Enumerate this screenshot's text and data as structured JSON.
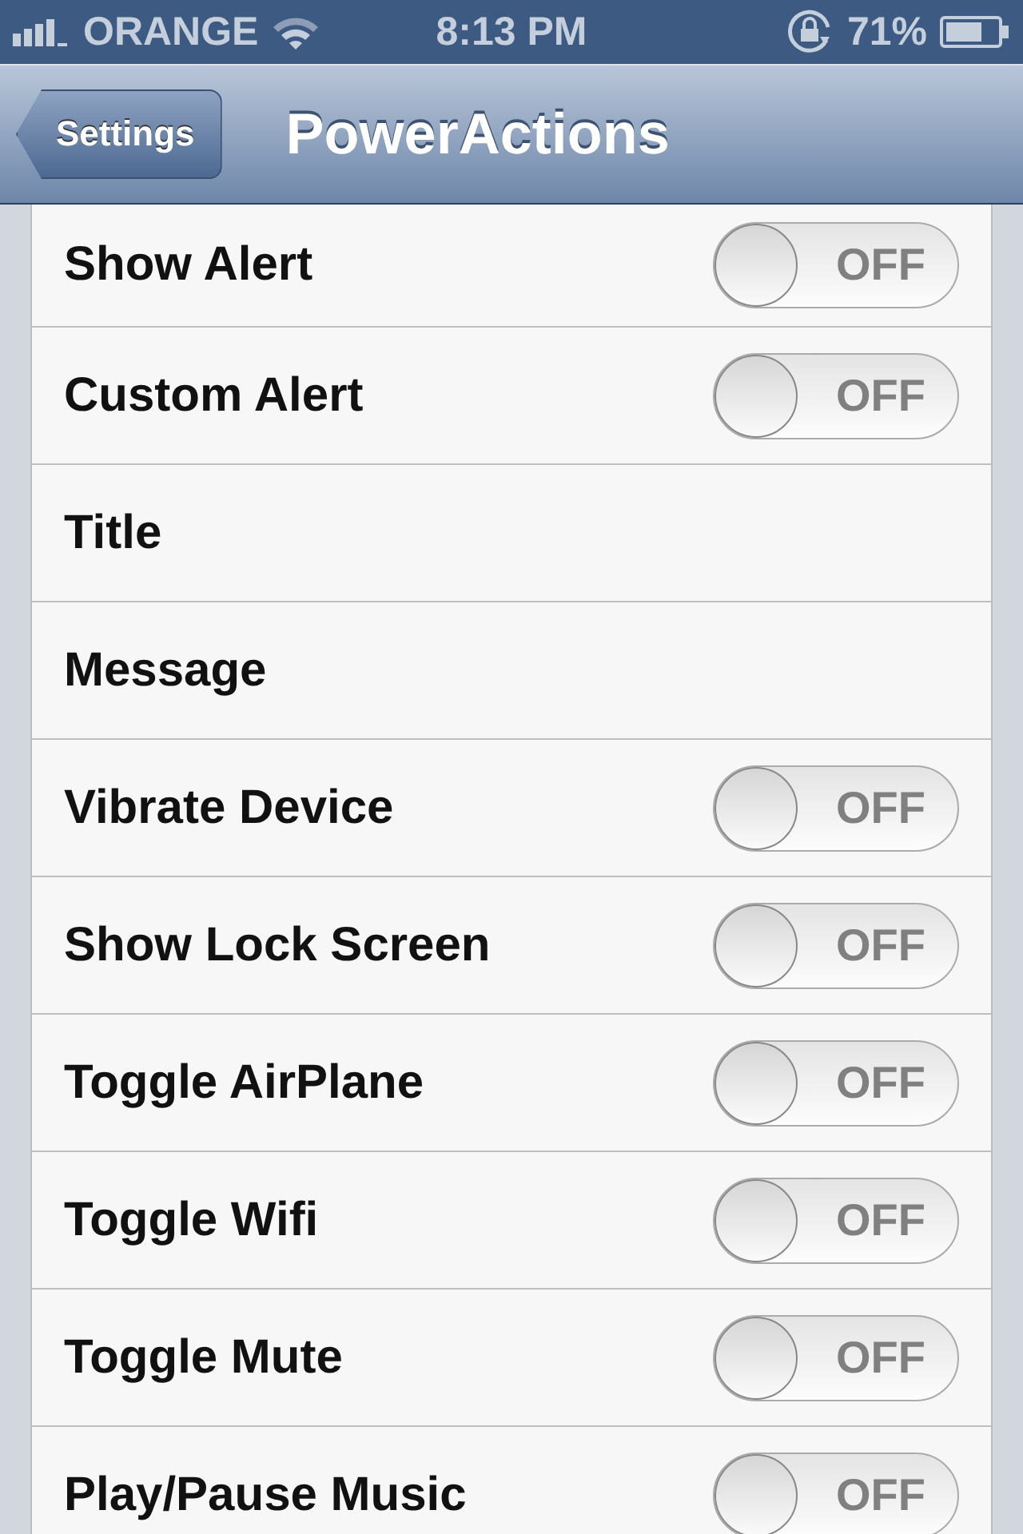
{
  "status_bar": {
    "carrier": "ORANGE",
    "time": "8:13 PM",
    "battery_percent": "71%"
  },
  "nav_bar": {
    "back_button": "Settings",
    "title": "PowerActions"
  },
  "rows": [
    {
      "kind": "switch",
      "label": "Show Alert",
      "on": false,
      "state_text": "OFF"
    },
    {
      "kind": "switch",
      "label": "Custom Alert",
      "on": false,
      "state_text": "OFF"
    },
    {
      "kind": "plain",
      "label": "Title"
    },
    {
      "kind": "plain",
      "label": "Message"
    },
    {
      "kind": "switch",
      "label": "Vibrate Device",
      "on": false,
      "state_text": "OFF"
    },
    {
      "kind": "switch",
      "label": "Show Lock Screen",
      "on": false,
      "state_text": "OFF"
    },
    {
      "kind": "switch",
      "label": "Toggle AirPlane",
      "on": false,
      "state_text": "OFF"
    },
    {
      "kind": "switch",
      "label": "Toggle Wifi",
      "on": false,
      "state_text": "OFF"
    },
    {
      "kind": "switch",
      "label": "Toggle Mute",
      "on": false,
      "state_text": "OFF"
    },
    {
      "kind": "switch",
      "label": "Play/Pause Music",
      "on": false,
      "state_text": "OFF"
    }
  ]
}
